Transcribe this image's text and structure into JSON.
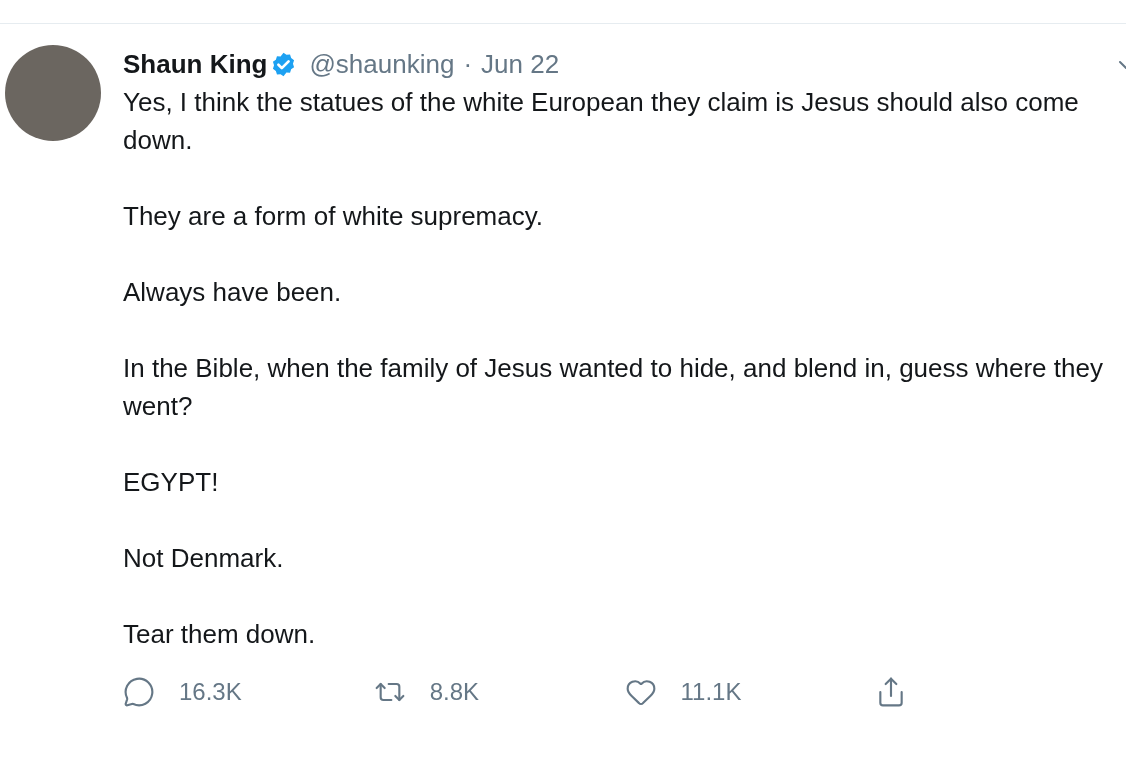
{
  "tweet": {
    "author": {
      "name": "Shaun King",
      "verified": true,
      "handle": "@shaunking",
      "separator": "·",
      "date": "Jun 22"
    },
    "paragraphs": [
      "Yes, I think the statues of the white European they claim is Jesus should also come down.",
      "They are a form of white supremacy.",
      "Always have been.",
      "In the Bible, when the family of Jesus wanted to hide, and blend in, guess where they went?",
      "EGYPT!",
      "Not Denmark.",
      "Tear them down."
    ],
    "actions": [
      {
        "kind": "reply",
        "count": "16.3K"
      },
      {
        "kind": "retweet",
        "count": "8.8K"
      },
      {
        "kind": "like",
        "count": "11.1K"
      },
      {
        "kind": "share"
      }
    ]
  }
}
